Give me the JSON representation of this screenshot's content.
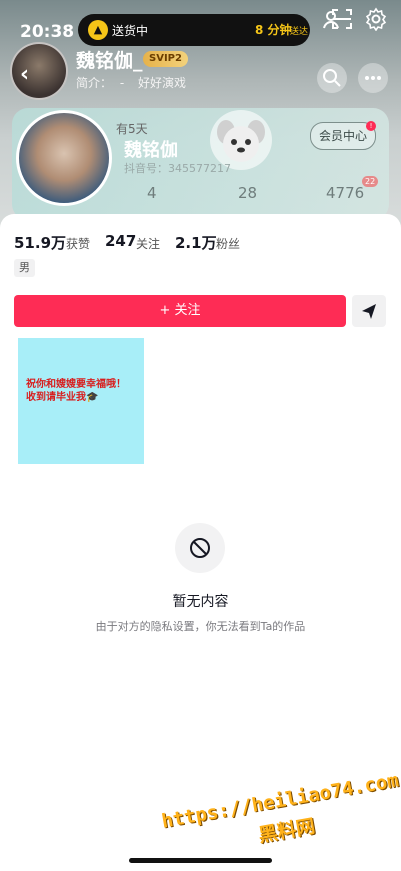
{
  "status": {
    "time": "20:38",
    "activity_icon": "delivery-icon",
    "activity_text": "送货中",
    "eta_text": "8 分钟",
    "eta_suffix": "送达"
  },
  "profile": {
    "name": "魏铭伽_",
    "badge": "SVIP2",
    "bio_prefix": "简介：",
    "bio_sep": "-",
    "bio": "好好演戏",
    "card_days": "有5天",
    "card_name": "魏铭伽",
    "douyin_id": "抖音号：345577217",
    "vip_center": "会员中心",
    "vip_dot": "!",
    "card_stats": [
      "4",
      "28",
      "4776"
    ],
    "card_badge": "22"
  },
  "stats": {
    "likes_num": "51.9万",
    "likes_label": "获赞",
    "following_num": "247",
    "following_label": "关注",
    "fans_num": "2.1万",
    "fans_label": "粉丝"
  },
  "gender": "男",
  "actions": {
    "follow_label": "+ 关注",
    "share_icon": "send-icon"
  },
  "post": {
    "text_line1": "祝你和嫂嫂要幸福哦！",
    "text_line2": "收到请毕业我🎓"
  },
  "empty": {
    "icon": "forbidden-icon",
    "title": "暂无内容",
    "subtitle": "由于对方的隐私设置，你无法看到Ta的作品"
  },
  "watermark": {
    "url": "https://heiliao74.com",
    "name": "黑料网"
  },
  "colors": {
    "accent": "#fe2c55",
    "vip_gold": "#e6b24a",
    "watermark": "#ffb21a"
  }
}
